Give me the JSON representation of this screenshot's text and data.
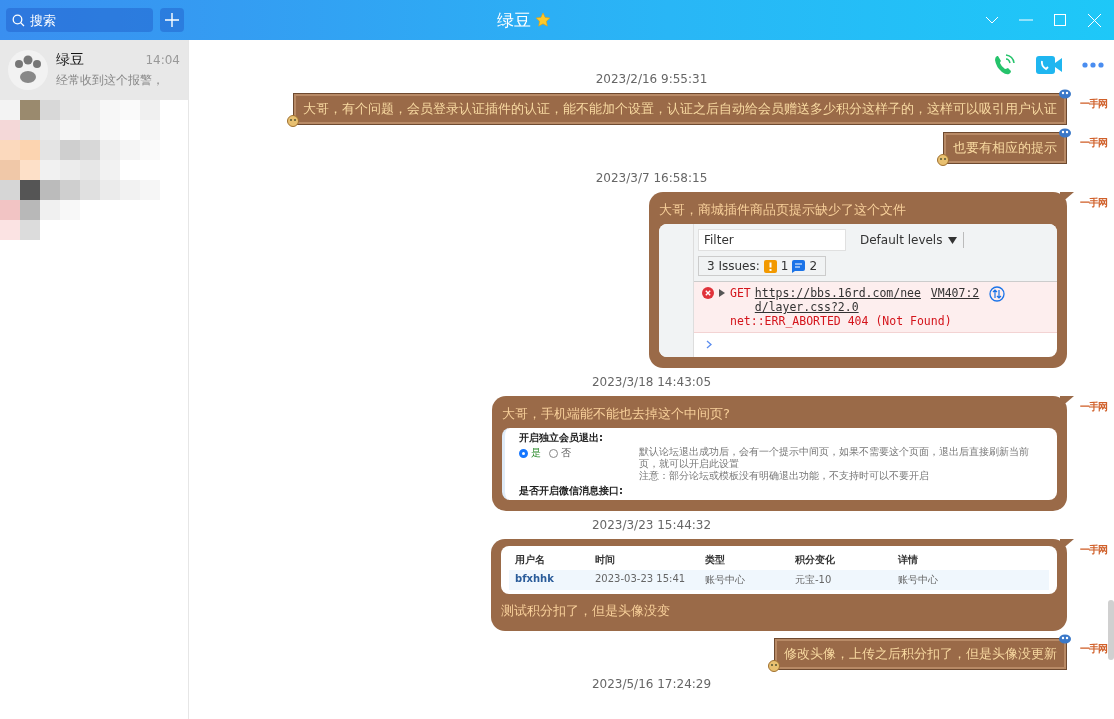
{
  "window": {
    "title": "绿豆"
  },
  "search": {
    "placeholder": "搜索"
  },
  "contacts": [
    {
      "name": "绿豆",
      "time": "14:04",
      "preview": "经常收到这个报警，",
      "selected": true
    }
  ],
  "chat": {
    "messages": [
      {
        "kind": "time",
        "text": "2023/2/16 9:55:31"
      },
      {
        "kind": "text",
        "banner": true,
        "avatar": "一手网",
        "text": "大哥，有个问题，会员登录认证插件的认证，能不能加个设置，认证之后自动给会员赠送多少积分这样子的，这样可以吸引用户认证"
      },
      {
        "kind": "text",
        "banner": true,
        "avatar": "一手网",
        "text": "也要有相应的提示"
      },
      {
        "kind": "time",
        "text": "2023/3/7 16:58:15"
      },
      {
        "kind": "devtools",
        "banner": false,
        "avatar": "一手网",
        "text": "大哥，商城插件商品页提示缺少了这个文件",
        "shot": {
          "filter_placeholder": "Filter",
          "levels": "Default levels",
          "issues": "3 Issues:",
          "warnings": "1",
          "infos": "2",
          "method": "GET",
          "url": "https://bbs.16rd.com/need/layer.css?2.0",
          "source": "VM407:2",
          "error": "net::ERR_ABORTED 404 (Not Found)"
        }
      },
      {
        "kind": "time",
        "text": "2023/3/18 14:43:05"
      },
      {
        "kind": "settings",
        "banner": false,
        "avatar": "一手网",
        "text": "大哥，手机端能不能也去掉这个中间页?",
        "shot": {
          "title": "开启独立会员退出:",
          "options": [
            {
              "label": "是",
              "selected": true
            },
            {
              "label": "否",
              "selected": false
            }
          ],
          "notes": [
            "默认论坛退出成功后，会有一个提示中间页，如果不需要这个页面，退出后直接刷新当前页，就可以开启此设置",
            "注意：部分论坛或模板没有明确退出功能，不支持时可以不要开启"
          ],
          "next_title": "是否开启微信消息接口:"
        }
      },
      {
        "kind": "time",
        "text": "2023/3/23 15:44:32"
      },
      {
        "kind": "table",
        "banner": false,
        "avatar": "一手网",
        "text": "测试积分扣了，但是头像没变",
        "shot": {
          "columns": [
            "用户名",
            "时间",
            "类型",
            "积分变化",
            "详情"
          ],
          "rows": [
            [
              "bfxhhk",
              "2023-03-23 15:41",
              "账号中心",
              "元宝-10",
              "账号中心"
            ]
          ]
        }
      },
      {
        "kind": "text",
        "banner": true,
        "avatar": "一手网",
        "text": "修改头像，上传之后积分扣了，但是头像没更新"
      },
      {
        "kind": "time",
        "text": "2023/5/16 17:24:29"
      }
    ]
  }
}
